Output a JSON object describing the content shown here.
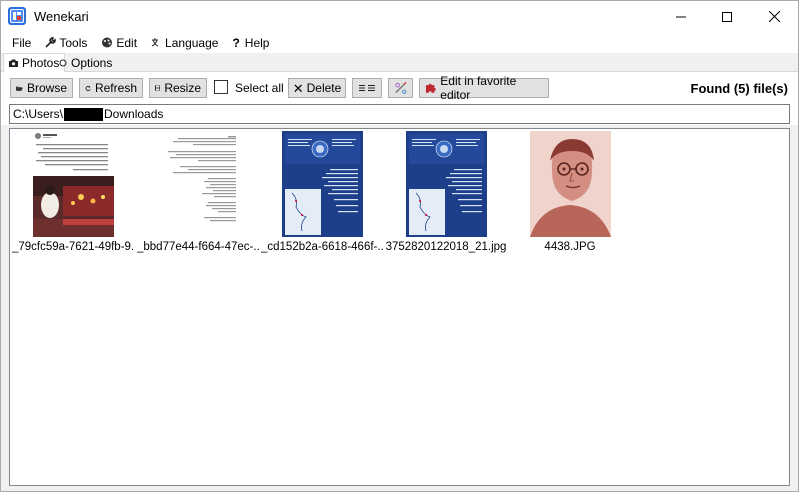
{
  "window": {
    "title": "Wenekari",
    "app_icon": "app-logo-icon",
    "controls": [
      "minimize-icon",
      "maximize-icon",
      "close-icon"
    ]
  },
  "menu": [
    {
      "label": "File",
      "icon": ""
    },
    {
      "label": "Tools",
      "icon": "wrench-icon"
    },
    {
      "label": "Edit",
      "icon": "paint-icon"
    },
    {
      "label": "Language",
      "icon": "language-icon"
    },
    {
      "label": "Help",
      "icon": "question-icon"
    }
  ],
  "tabs": [
    {
      "label": "Photos",
      "icon": "photo-icon",
      "active": true
    },
    {
      "label": "Options",
      "icon": "radio-icon",
      "active": false
    }
  ],
  "toolbar": {
    "browse": "Browse",
    "refresh": "Refresh",
    "resize": "Resize",
    "select_all": "Select all",
    "delete": "Delete",
    "list_icon": "list-view-icon",
    "tool_icon": "magic-tool-icon",
    "edit_fav": "Edit in favorite editor",
    "found": "Found (5) file(s)"
  },
  "path": {
    "prefix": "C:\\Users\\",
    "suffix": "Downloads"
  },
  "files": [
    {
      "name": "_79cfc59a-7621-49fb-9...",
      "kind": "social-post"
    },
    {
      "name": "_bbd77e44-f664-47ec-...",
      "kind": "text-document"
    },
    {
      "name": "_cd152b2a-6618-466f-...",
      "kind": "blue-map-poster"
    },
    {
      "name": "3752820122018_21.jpg",
      "kind": "blue-map-poster"
    },
    {
      "name": "4438.JPG",
      "kind": "sepia-portrait"
    }
  ],
  "colors": {
    "accent_blue": "#1d3f8a",
    "sepia": "#d48f82"
  }
}
